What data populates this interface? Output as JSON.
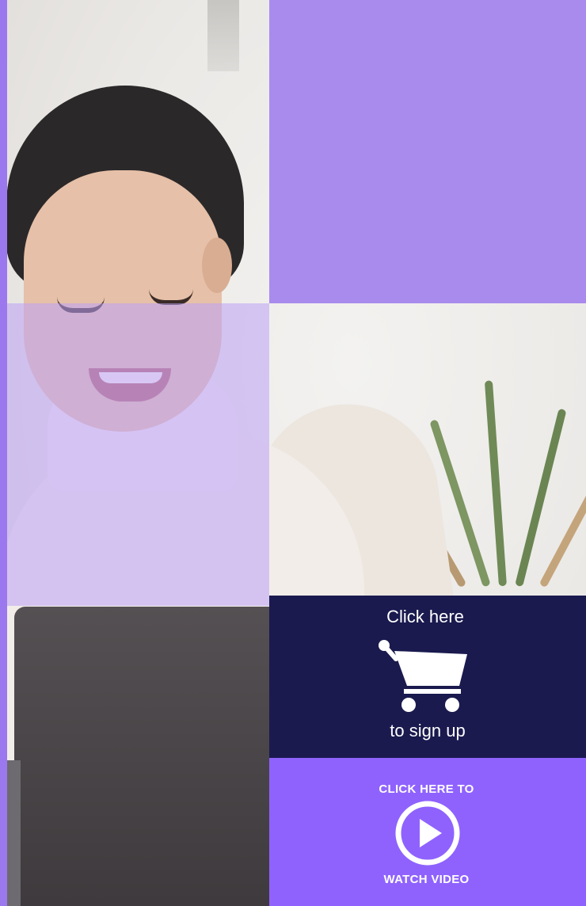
{
  "signup": {
    "line1": "Click here",
    "line2": "to sign up",
    "icon": "shopping-cart-icon"
  },
  "video": {
    "line1": "CLICK HERE TO",
    "line2": "WATCH VIDEO",
    "icon": "play-circle-icon"
  },
  "colors": {
    "purple_top": "#a98bed",
    "navy": "#1a1a4f",
    "violet": "#8f62fe",
    "left_stripe": "#9c78ee"
  }
}
